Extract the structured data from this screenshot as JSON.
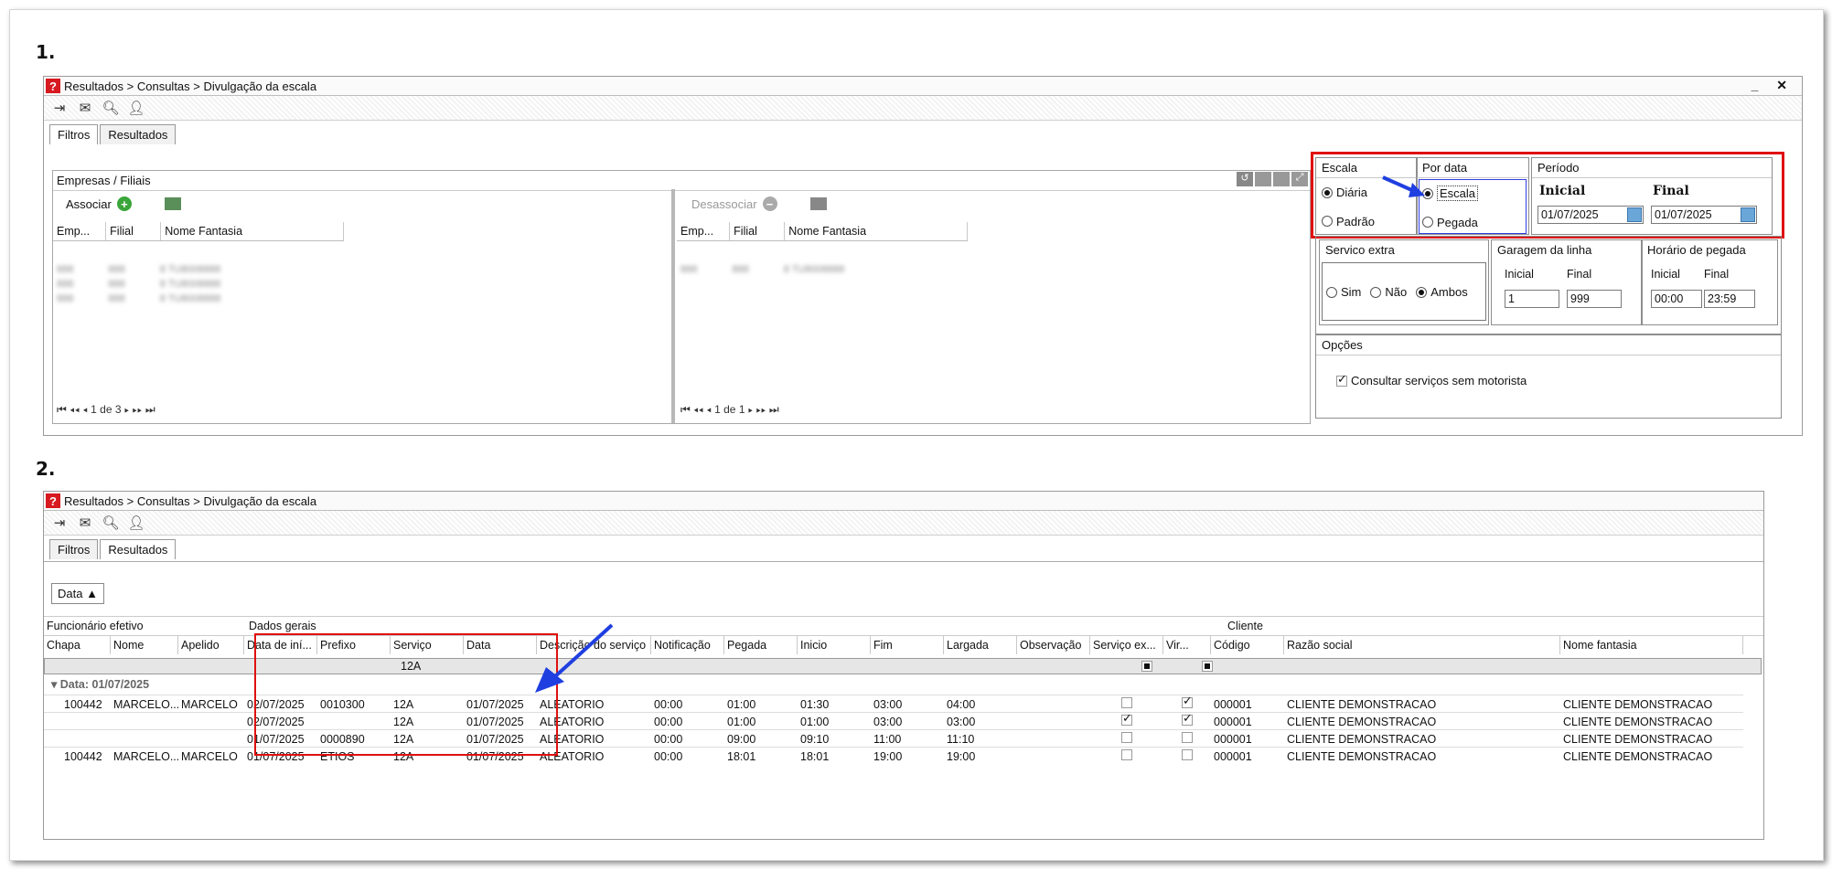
{
  "steps": {
    "one": "1.",
    "two": "2."
  },
  "window": {
    "breadcrumb": "Resultados > Consultas > Divulgação da escala",
    "controls": "_ ✕"
  },
  "toolbar": {
    "icons": [
      "exit-icon",
      "message-icon",
      "search-icon",
      "user-icon"
    ]
  },
  "tabs": {
    "filtros": "Filtros",
    "resultados": "Resultados"
  },
  "empresas": {
    "title": "Empresas / Filiais",
    "associar": "Associar",
    "desassociar": "Desassociar",
    "cols": {
      "emp": "Emp...",
      "filial": "Filial",
      "nome": "Nome Fantasia"
    },
    "pager_left": "1 de 3",
    "pager_right": "1 de 1"
  },
  "filters": {
    "escala": {
      "title": "Escala",
      "diaria": "Diária",
      "padrao": "Padrão",
      "selected": "Diária"
    },
    "por_data": {
      "title": "Por data",
      "escala": "Escala",
      "pegada": "Pegada",
      "selected": "Escala"
    },
    "periodo": {
      "title": "Período",
      "inicial_label": "Inicial",
      "final_label": "Final",
      "inicial": "01/07/2025",
      "final": "01/07/2025"
    },
    "servico_extra": {
      "title": "Servico extra",
      "sim": "Sim",
      "nao": "Não",
      "ambos": "Ambos",
      "selected": "Ambos"
    },
    "garagem": {
      "title": "Garagem da linha",
      "inicial_label": "Inicial",
      "final_label": "Final",
      "inicial": "1",
      "final": "999"
    },
    "horario": {
      "title": "Horário de pegada",
      "inicial_label": "Inicial",
      "final_label": "Final",
      "inicial": "00:00",
      "final": "23:59"
    },
    "opcoes": {
      "title": "Opções",
      "consultar": "Consultar serviços sem motorista",
      "checked": true
    }
  },
  "results": {
    "group_by": "Data",
    "bands": {
      "funcionario": "Funcionário efetivo",
      "dados": "Dados gerais",
      "cliente": "Cliente"
    },
    "columns": [
      "Chapa",
      "Nome",
      "Apelido",
      "Data de iní...",
      "Prefixo",
      "Serviço",
      "Data",
      "Descrição do serviço",
      "Notificação",
      "Pegada",
      "Inicio",
      "Fim",
      "Largada",
      "Observação",
      "Serviço ex...",
      "Vir...",
      "Código",
      "Razão social",
      "Nome fantasia"
    ],
    "filter_servico": "12A",
    "group_label": "Data: 01/07/2025",
    "rows": [
      {
        "chapa": "100442",
        "nome": "MARCELO...",
        "apelido": "MARCELO",
        "data_ini": "02/07/2025",
        "prefixo": "0010300",
        "servico": "12A",
        "data": "01/07/2025",
        "descricao": "ALEATORIO",
        "notificacao": "00:00",
        "pegada": "01:00",
        "inicio": "01:30",
        "fim": "03:00",
        "largada": "04:00",
        "obs": "",
        "extra": false,
        "vir": true,
        "codigo": "000001",
        "razao": "CLIENTE DEMONSTRACAO",
        "fantasia": "CLIENTE DEMONSTRACAO"
      },
      {
        "chapa": "",
        "nome": "",
        "apelido": "",
        "data_ini": "02/07/2025",
        "prefixo": "",
        "servico": "12A",
        "data": "01/07/2025",
        "descricao": "ALEATORIO",
        "notificacao": "00:00",
        "pegada": "01:00",
        "inicio": "01:00",
        "fim": "03:00",
        "largada": "03:00",
        "obs": "",
        "extra": true,
        "vir": true,
        "codigo": "000001",
        "razao": "CLIENTE DEMONSTRACAO",
        "fantasia": "CLIENTE DEMONSTRACAO"
      },
      {
        "chapa": "",
        "nome": "",
        "apelido": "",
        "data_ini": "01/07/2025",
        "prefixo": "0000890",
        "servico": "12A",
        "data": "01/07/2025",
        "descricao": "ALEATORIO",
        "notificacao": "00:00",
        "pegada": "09:00",
        "inicio": "09:10",
        "fim": "11:00",
        "largada": "11:10",
        "obs": "",
        "extra": false,
        "vir": false,
        "codigo": "000001",
        "razao": "CLIENTE DEMONSTRACAO",
        "fantasia": "CLIENTE DEMONSTRACAO"
      },
      {
        "chapa": "100442",
        "nome": "MARCELO...",
        "apelido": "MARCELO",
        "data_ini": "01/07/2025",
        "prefixo": "ETIOS",
        "servico": "12A",
        "data": "01/07/2025",
        "descricao": "ALEATORIO",
        "notificacao": "00:00",
        "pegada": "18:01",
        "inicio": "18:01",
        "fim": "19:00",
        "largada": "19:00",
        "obs": "",
        "extra": false,
        "vir": false,
        "codigo": "000001",
        "razao": "CLIENTE DEMONSTRACAO",
        "fantasia": "CLIENTE DEMONSTRACAO"
      }
    ]
  },
  "colors": {
    "highlight_red": "#e01010",
    "arrow_blue": "#1f3fe0",
    "logo_red": "#d71920"
  }
}
